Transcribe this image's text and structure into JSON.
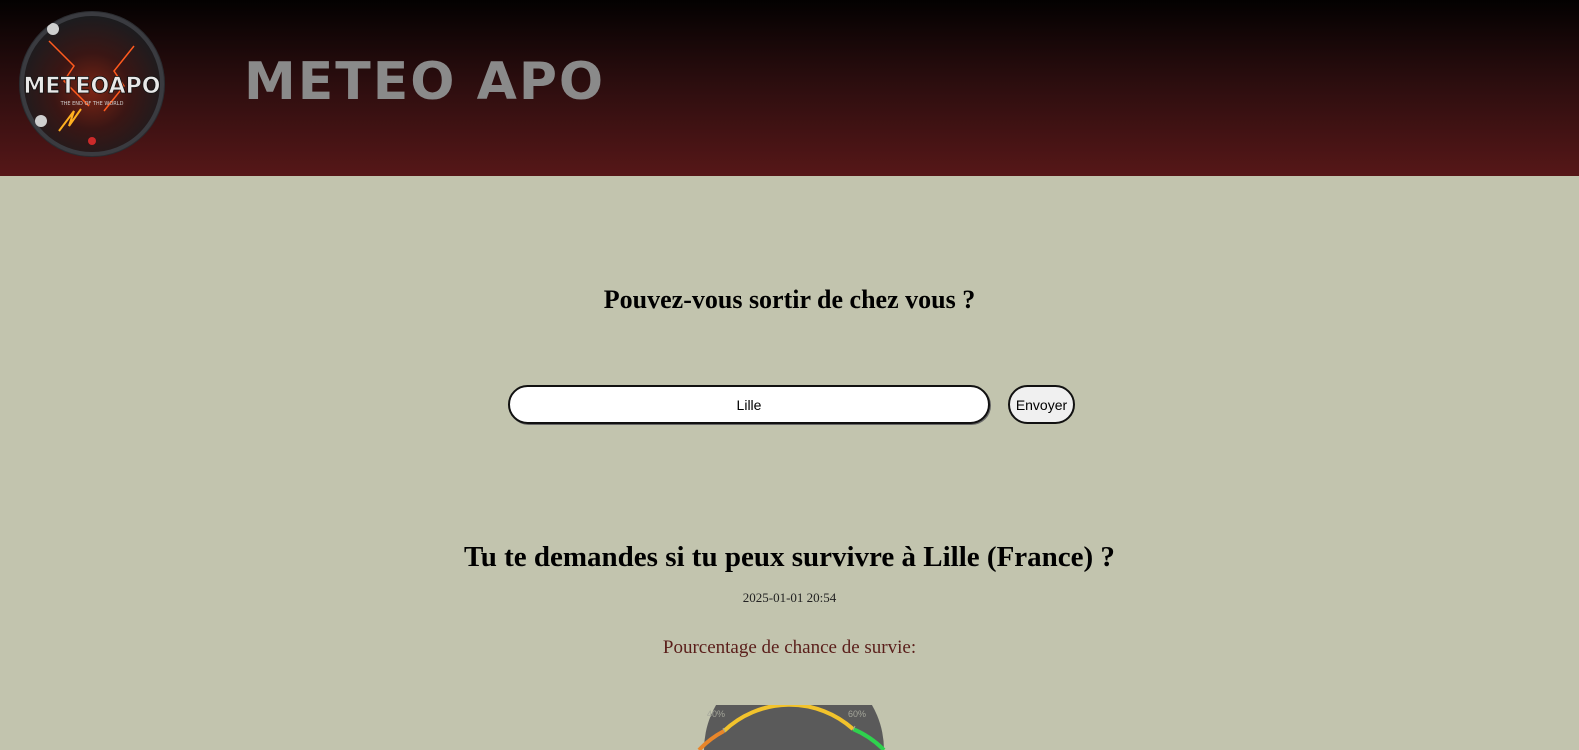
{
  "header": {
    "logo_text": "METEOAPO",
    "logo_tagline": "THE END OF THE WORLD",
    "site_title": "METEO APO"
  },
  "form": {
    "question": "Pouvez-vous sortir de chez vous ?",
    "city_value": "Lille",
    "submit_label": "Envoyer"
  },
  "result": {
    "title": "Tu te demandes si tu peux survivre à Lille (France) ?",
    "datetime": "2025-01-01 20:54",
    "survival_label": "Pourcentage de chance de survie:"
  },
  "gauge": {
    "tick_labels": [
      "40%",
      "60%"
    ],
    "colors": {
      "low": "#e8862a",
      "mid": "#f2c32c",
      "high": "#2fd24e",
      "dial": "#5a5a5a"
    }
  },
  "colors": {
    "page_background": "#c2c4ae",
    "header_top": "#030101",
    "header_bottom": "#561718",
    "title_gray": "#8a8a8a"
  }
}
